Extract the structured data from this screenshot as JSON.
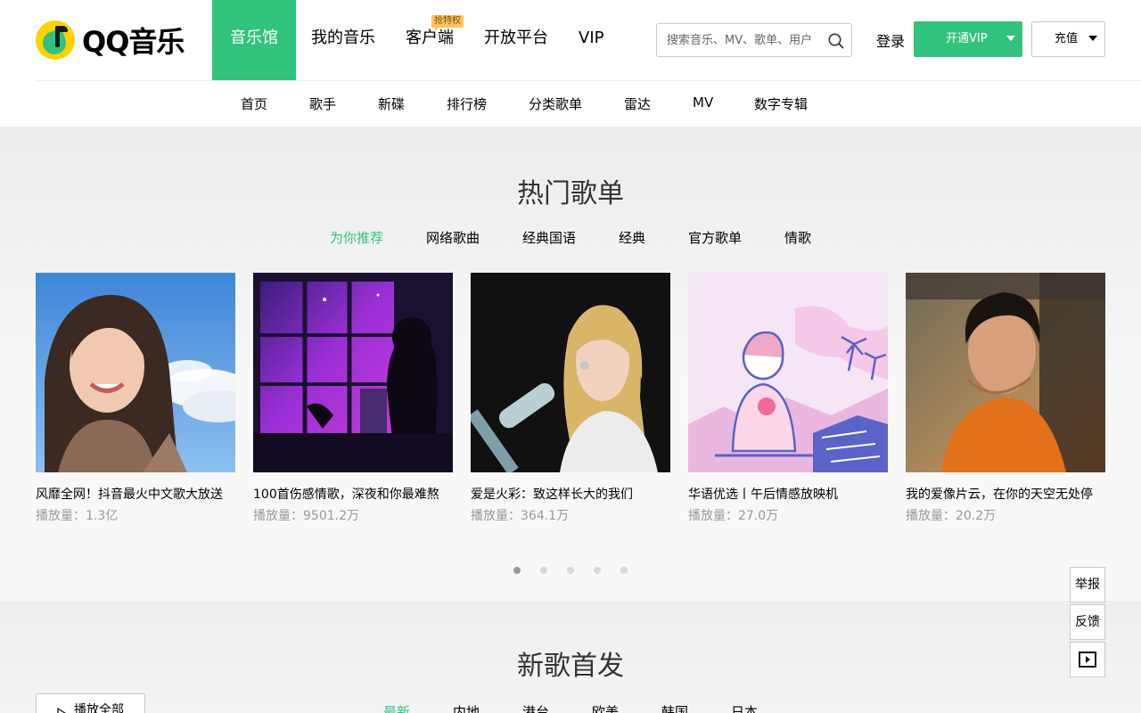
{
  "brand": {
    "logo_text": "QQ音乐"
  },
  "main_nav": [
    {
      "label": "音乐馆",
      "active": true
    },
    {
      "label": "我的音乐"
    },
    {
      "label": "客户端",
      "badge": "抢特权"
    },
    {
      "label": "开放平台"
    },
    {
      "label": "VIP"
    }
  ],
  "search": {
    "placeholder": "搜索音乐、MV、歌单、用户",
    "icon": "search-icon"
  },
  "user": {
    "login": "登录",
    "vip_button": "开通VIP",
    "charge_button": "充值"
  },
  "sub_nav": [
    "首页",
    "歌手",
    "新碟",
    "排行榜",
    "分类歌单",
    "雷达",
    "MV",
    "数字专辑"
  ],
  "hot_playlists": {
    "title": "热门歌单",
    "tabs": [
      "为你推荐",
      "网络歌曲",
      "经典国语",
      "经典",
      "官方歌单",
      "情歌"
    ],
    "active_tab": 0,
    "items": [
      {
        "name": "风靡全网！抖音最火中文歌大放送",
        "plays": "播放量：1.3亿"
      },
      {
        "name": "100首伤感情歌，深夜和你最难熬",
        "plays": "播放量：9501.2万"
      },
      {
        "name": "爱是火彩：致这样长大的我们",
        "plays": "播放量：364.1万"
      },
      {
        "name": "华语优选丨午后情感放映机",
        "plays": "播放量：27.0万"
      },
      {
        "name": "我的爱像片云，在你的天空无处停",
        "plays": "播放量：20.2万"
      }
    ],
    "page_count": 5,
    "current_page": 0
  },
  "new_songs": {
    "title": "新歌首发",
    "play_all": "播放全部",
    "tabs": [
      "最新",
      "内地",
      "港台",
      "欧美",
      "韩国",
      "日本"
    ],
    "active_tab": 0
  },
  "side_tools": {
    "report": "举报",
    "feedback": "反馈",
    "video_icon": "video-play-icon"
  },
  "colors": {
    "accent": "#31c27c",
    "badge": "#ffc263"
  }
}
